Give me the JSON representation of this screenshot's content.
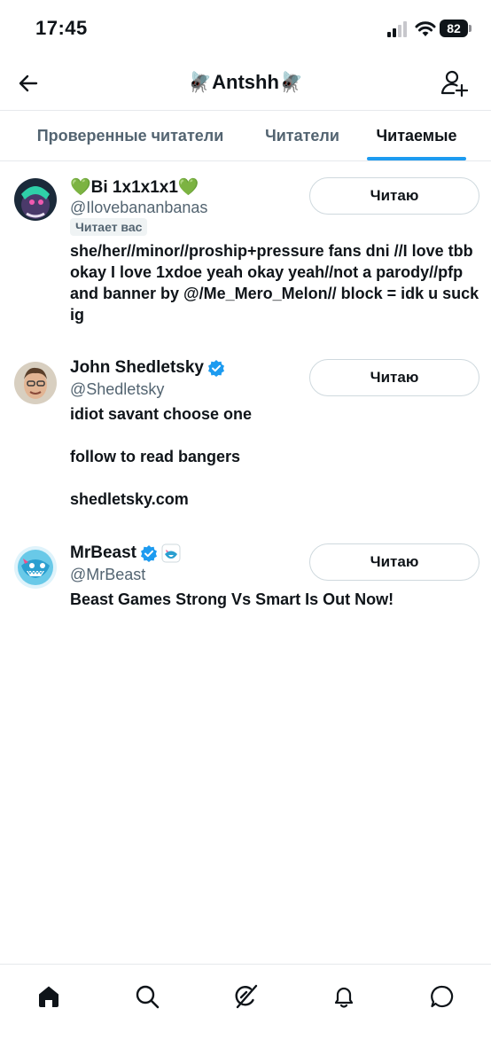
{
  "status_bar": {
    "time": "17:45",
    "battery": "82"
  },
  "header": {
    "title": "🪰Antshh🪰"
  },
  "tabs": [
    {
      "label": "Проверенные читатели",
      "active": false
    },
    {
      "label": "Читатели",
      "active": false
    },
    {
      "label": "Читаемые",
      "active": true
    }
  ],
  "users": [
    {
      "name": "💚Bi 1x1x1x1💚",
      "handle": "@Ilovebananbanas",
      "verified": false,
      "follows_you": "Читает вас",
      "bio": [
        "she/her//minor//proship+pressure fans dni  //I love tbb okay I love 1xdoe yeah okay yeah//not a parody//pfp and banner by @/Me_Mero_Melon// block = idk u suck ig"
      ],
      "button": "Читаю"
    },
    {
      "name": "John Shedletsky",
      "handle": "@Shedletsky",
      "verified": true,
      "bio": [
        "idiot savant choose one",
        "follow to read bangers",
        "shedletsky.com"
      ],
      "button": "Читаю"
    },
    {
      "name": "MrBeast",
      "handle": "@MrBeast",
      "verified": true,
      "affiliate_badge": "shark-logo-icon",
      "bio": [
        "Beast Games Strong Vs Smart Is Out Now!"
      ],
      "button": "Читаю"
    }
  ],
  "colors": {
    "accent": "#1d9bf0",
    "text": "#0f1419",
    "secondary": "#536471",
    "border": "#cfd9de"
  },
  "icons": {
    "back": "arrow-left-icon",
    "add_user": "add-user-icon",
    "nav": [
      "home-icon",
      "search-icon",
      "grok-icon",
      "bell-icon",
      "messages-icon"
    ]
  }
}
